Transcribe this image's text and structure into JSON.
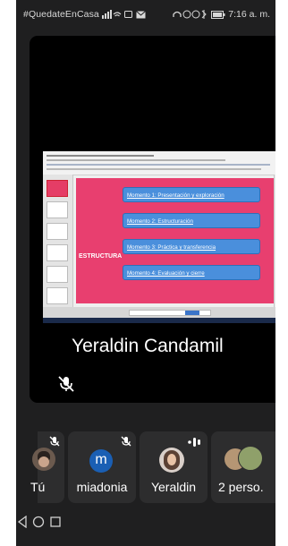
{
  "status_bar": {
    "left_text": "#QuedateEnCasa",
    "time": "7:16 a. m."
  },
  "main_tile": {
    "participant_name": "Yeraldin Candamil",
    "shared_slide": {
      "side_label": "ESTRUCTURA",
      "moments": [
        "Momento 1: Presentación y exploración",
        "Momento 2: Estructuración",
        "Momento 3: Práctica y transferencia",
        "Momento 4: Evaluación y cierre"
      ]
    }
  },
  "participants": [
    {
      "name": "Tú",
      "muted": true
    },
    {
      "name": "miadonia",
      "initial": "m",
      "muted": true,
      "avatar_color": "#1a5fb4"
    },
    {
      "name": "Yeraldin",
      "speaking": true
    },
    {
      "name": "2 perso."
    }
  ],
  "colors": {
    "background": "#1f1f20",
    "card": "#2d2d2e",
    "slide_pink": "#e83f6f",
    "moment_blue": "#4a8fdc"
  },
  "icons": [
    "wifi-icon",
    "signal-icon",
    "headphones-icon",
    "mic-off-icon",
    "audio-level-icon",
    "back-nav-icon",
    "home-nav-icon",
    "recents-nav-icon"
  ]
}
